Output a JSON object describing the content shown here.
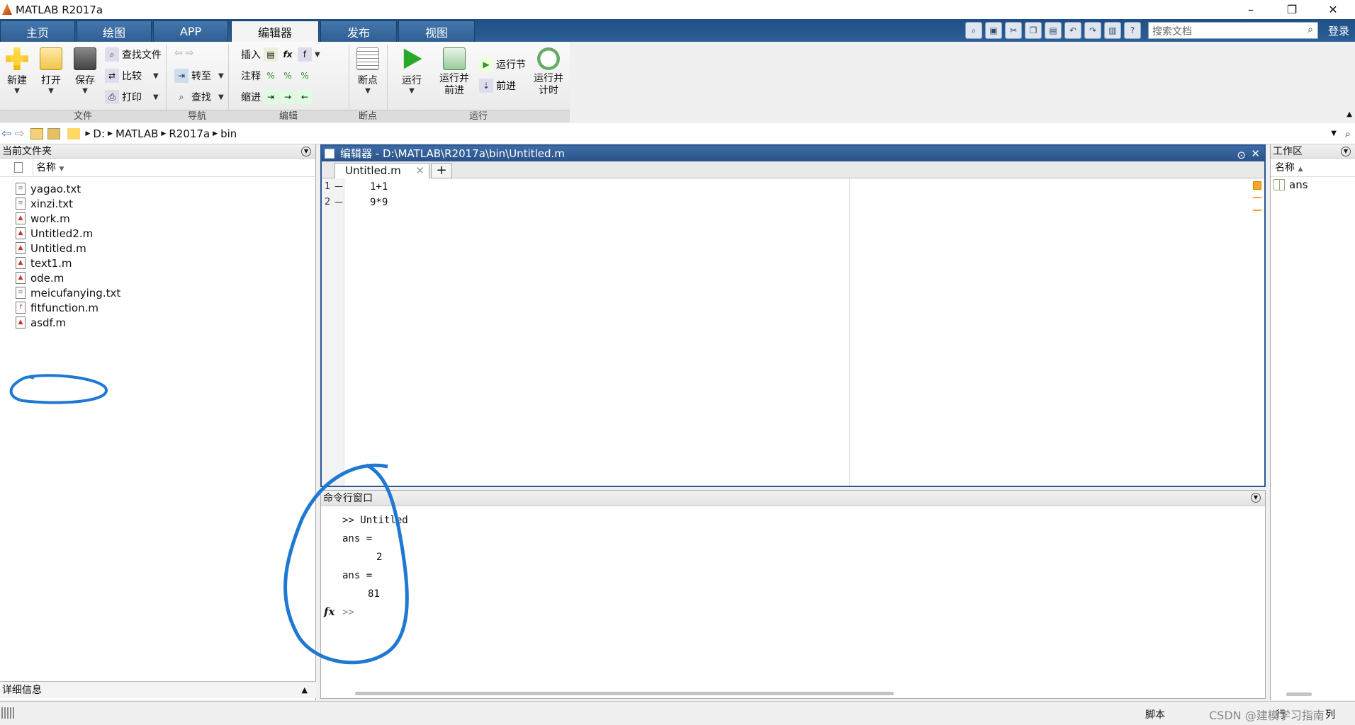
{
  "window": {
    "title": "MATLAB R2017a"
  },
  "tabs": [
    "主页",
    "绘图",
    "APP",
    "编辑器",
    "发布",
    "视图"
  ],
  "search": {
    "placeholder": "搜索文档"
  },
  "login": "登录",
  "ribbon": {
    "file": {
      "new": "新建",
      "open": "打开",
      "save": "保存",
      "find_files": "查找文件",
      "compare": "比较",
      "print": "打印",
      "group": "文件"
    },
    "nav": {
      "goto": "转至",
      "find": "查找",
      "group": "导航"
    },
    "edit": {
      "insert": "插入",
      "comment": "注释",
      "indent": "缩进",
      "group": "编辑"
    },
    "breakpoints": {
      "label": "断点",
      "group": "断点"
    },
    "run": {
      "run": "运行",
      "run_advance": "运行并\n前进",
      "run_section": "运行节",
      "advance": "前进",
      "run_time": "运行并\n计时",
      "group": "运行"
    }
  },
  "address": {
    "parts": [
      "D:",
      "MATLAB",
      "R2017a",
      "bin"
    ]
  },
  "file_panel": {
    "title": "当前文件夹",
    "col_name": "名称",
    "files": [
      "yagao.txt",
      "xinzi.txt",
      "work.m",
      "Untitled2.m",
      "Untitled.m",
      "text1.m",
      "ode.m",
      "meicufanying.txt",
      "fitfunction.m",
      "asdf.m"
    ],
    "details": "详细信息"
  },
  "editor": {
    "title": "编辑器 - D:\\MATLAB\\R2017a\\bin\\Untitled.m",
    "tab": "Untitled.m",
    "lines": [
      {
        "n": "1",
        "code": "1+1"
      },
      {
        "n": "2",
        "code": "9*9"
      }
    ]
  },
  "command": {
    "title": "命令行窗口",
    "lines": [
      ">> Untitled",
      "ans =",
      "2",
      "ans =",
      "81"
    ],
    "prompt": ">>"
  },
  "workspace": {
    "title": "工作区",
    "col_name": "名称",
    "vars": [
      "ans"
    ]
  },
  "status": {
    "mode": "脚本",
    "ln": "行",
    "col": "列",
    "watermark": "CSDN @建模学习指南"
  }
}
